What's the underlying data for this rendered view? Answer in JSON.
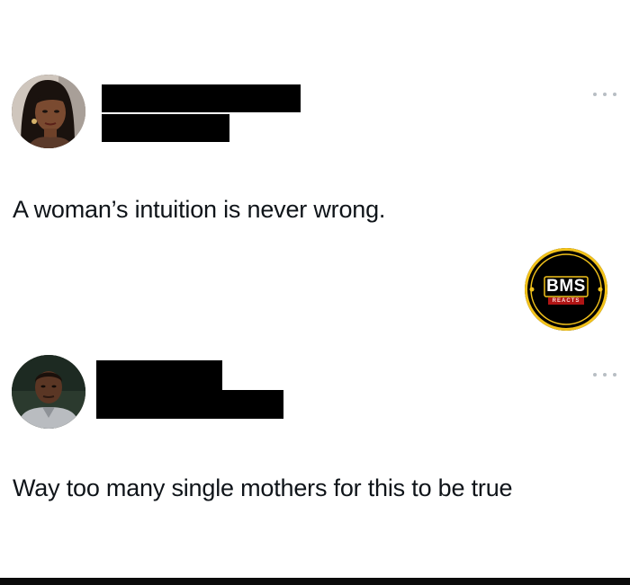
{
  "posts": [
    {
      "avatar": "avatar-woman",
      "name_redacted": true,
      "handle_redacted": true,
      "more_icon": "more-dots-icon",
      "text": "A woman’s intuition is never wrong."
    },
    {
      "avatar": "avatar-man",
      "name_redacted": true,
      "handle_redacted": true,
      "more_icon": "more-dots-icon",
      "text": "Way too many single mothers for this to be true"
    }
  ],
  "watermark": {
    "logo_text": "BMS",
    "sub_text": "REACTS",
    "colors": {
      "background": "#000000",
      "ring": "#f2c21b",
      "ribbon": "#b01515",
      "text": "#ffffff"
    }
  }
}
